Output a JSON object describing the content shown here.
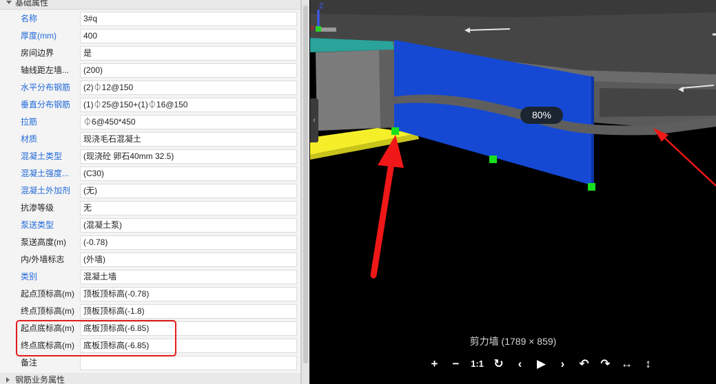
{
  "panel": {
    "section_basic": "基础属性",
    "section_rebar": "钢筋业务属性",
    "properties": [
      {
        "label": "名称",
        "value": "3#q",
        "link": true
      },
      {
        "label": "厚度(mm)",
        "value": "400",
        "link": true
      },
      {
        "label": "房间边界",
        "value": "是",
        "link": false
      },
      {
        "label": "轴线距左墙...",
        "value": "(200)",
        "link": false
      },
      {
        "label": "水平分布钢筋",
        "value": "(2)⏀12@150",
        "link": true
      },
      {
        "label": "垂直分布钢筋",
        "value": "(1)⏀25@150+(1)⏀16@150",
        "link": true
      },
      {
        "label": "拉筋",
        "value": "⏀6@450*450",
        "link": true
      },
      {
        "label": "材质",
        "value": "现浇毛石混凝土",
        "link": true
      },
      {
        "label": "混凝土类型",
        "value": "(现浇砼 卵石40mm 32.5)",
        "link": true
      },
      {
        "label": "混凝土强度...",
        "value": "(C30)",
        "link": true
      },
      {
        "label": "混凝土外加剂",
        "value": "(无)",
        "link": true
      },
      {
        "label": "抗渗等级",
        "value": "无",
        "link": false
      },
      {
        "label": "泵送类型",
        "value": "(混凝土泵)",
        "link": true
      },
      {
        "label": "泵送高度(m)",
        "value": "(-0.78)",
        "link": false
      },
      {
        "label": "内/外墙标志",
        "value": "(外墙)",
        "link": false
      },
      {
        "label": "类别",
        "value": "混凝土墙",
        "link": true
      },
      {
        "label": "起点顶标高(m)",
        "value": "顶板顶标高(-0.78)",
        "link": false
      },
      {
        "label": "终点顶标高(m)",
        "value": "顶板顶标高(-1.8)",
        "link": false
      },
      {
        "label": "起点底标高(m)",
        "value": "底板顶标高(-6.85)",
        "link": false
      },
      {
        "label": "终点底标高(m)",
        "value": "底板顶标高(-6.85)",
        "link": false
      },
      {
        "label": "备注",
        "value": "",
        "link": false
      }
    ]
  },
  "viewer": {
    "zoom": "80%",
    "caption": "剪力墙 (1789 × 859)",
    "toolbar": [
      {
        "name": "zoom-in",
        "glyph": "+"
      },
      {
        "name": "zoom-out",
        "glyph": "−"
      },
      {
        "name": "actual-size",
        "glyph": "1:1"
      },
      {
        "name": "reset",
        "glyph": "↻"
      },
      {
        "name": "previous",
        "glyph": "‹"
      },
      {
        "name": "play",
        "glyph": "▶"
      },
      {
        "name": "next",
        "glyph": "›"
      },
      {
        "name": "rotate-left",
        "glyph": "↶"
      },
      {
        "name": "rotate-right",
        "glyph": "↷"
      },
      {
        "name": "flip-horizontal",
        "glyph": "↔"
      },
      {
        "name": "flip-vertical",
        "glyph": "↕"
      }
    ],
    "collapse_glyph": "‹",
    "axis": {
      "z": "Z",
      "x": "X"
    }
  },
  "colors": {
    "wall": "#1549d4",
    "annotation": "#e11b1b",
    "handle": "#18e01d",
    "link_label": "#1f68d8"
  }
}
